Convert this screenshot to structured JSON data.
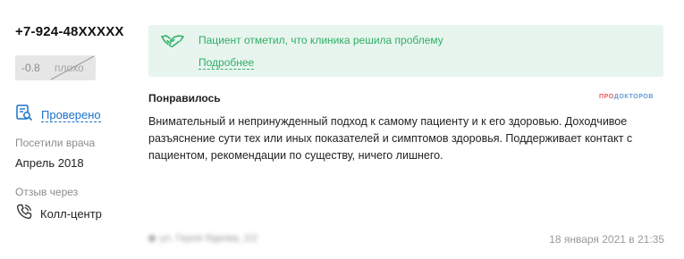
{
  "doctor": {
    "phone": "+7-924-48XXXXX",
    "rating_score": "-0.8",
    "rating_label": "плохо"
  },
  "verified_label": "Проверено",
  "visit": {
    "label": "Посетили врача",
    "value": "Апрель 2018"
  },
  "review_via": {
    "label": "Отзыв через",
    "value": "Колл-центр"
  },
  "banner": {
    "message": "Пациент отметил, что клиника решила проблему",
    "more_link": "Подробнее"
  },
  "review": {
    "heading": "Понравилось",
    "brand_part1": "ПРО",
    "brand_part2": "ДОКТОРОВ",
    "text": "Внимательный и непринужденный подход к самому пациенту и к его здоровью. Доходчивое разъяснение сути тех или иных показателей и симптомов здоровья. Поддерживает контакт с пациентом, рекомендации по существу, ничего лишнего."
  },
  "footer": {
    "address": "ул. Героя Ядкова, 2/2",
    "date": "18 января 2021 в 21:35"
  },
  "colors": {
    "accent_blue": "#1a73c9",
    "success_green": "#2fae67",
    "banner_bg": "#e7f5ee",
    "brand_red": "#e9595a",
    "brand_blue": "#5f9bd6"
  },
  "icons": [
    "search-document-icon",
    "phone-icon",
    "handshake-icon",
    "map-pin-icon"
  ]
}
